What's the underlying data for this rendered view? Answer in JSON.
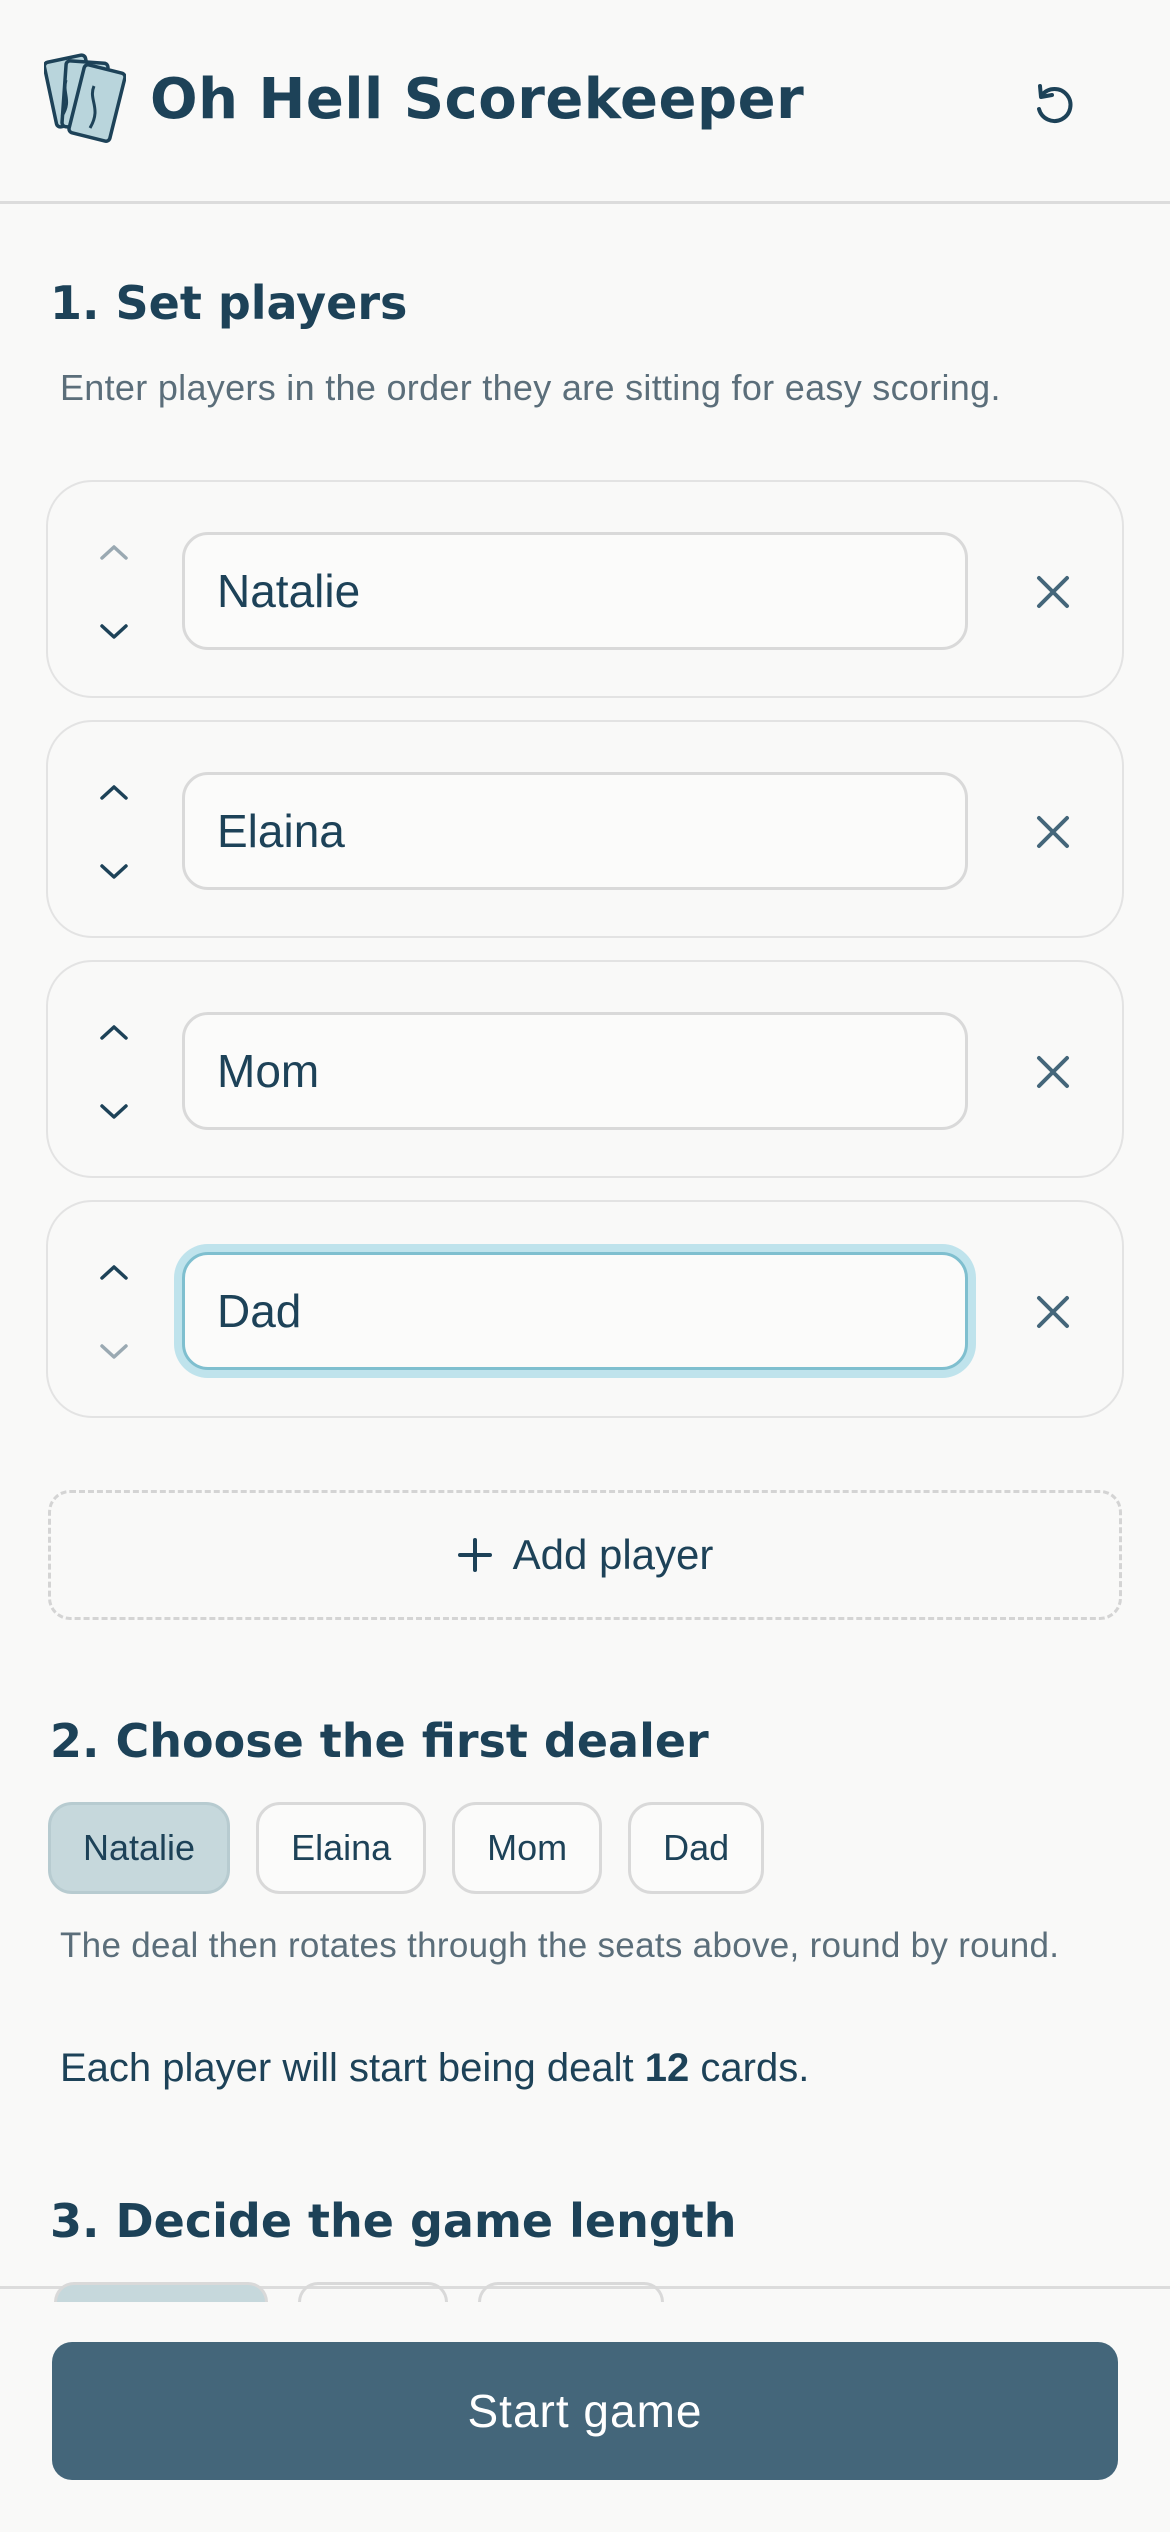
{
  "header": {
    "title": "Oh Hell Scorekeeper",
    "logo_icon": "cards-icon",
    "reset_icon": "reset-icon"
  },
  "section1": {
    "title": "1. Set players",
    "hint": "Enter players in the order they are sitting for easy scoring."
  },
  "players": [
    {
      "name": "Natalie",
      "up_enabled": false,
      "down_enabled": true,
      "focused": false
    },
    {
      "name": "Elaina",
      "up_enabled": true,
      "down_enabled": true,
      "focused": false
    },
    {
      "name": "Mom",
      "up_enabled": true,
      "down_enabled": true,
      "focused": false
    },
    {
      "name": "Dad",
      "up_enabled": true,
      "down_enabled": false,
      "focused": true
    }
  ],
  "add_player_label": "Add player",
  "section2": {
    "title": "2. Choose the first dealer",
    "dealers": [
      "Natalie",
      "Elaina",
      "Mom",
      "Dad"
    ],
    "selected_dealer": "Natalie",
    "hint": "The deal then rotates through the seats above, round by round.",
    "deal_prefix": "Each player will start being dealt",
    "deal_count": "12",
    "deal_suffix": "cards."
  },
  "section3": {
    "title": "3. Decide the game length"
  },
  "footer": {
    "start_label": "Start game"
  },
  "colors": {
    "primary": "#1d4258",
    "button": "#44667a",
    "selected_chip": "#c6d8dc",
    "focus_ring": "#bfe3ec"
  }
}
